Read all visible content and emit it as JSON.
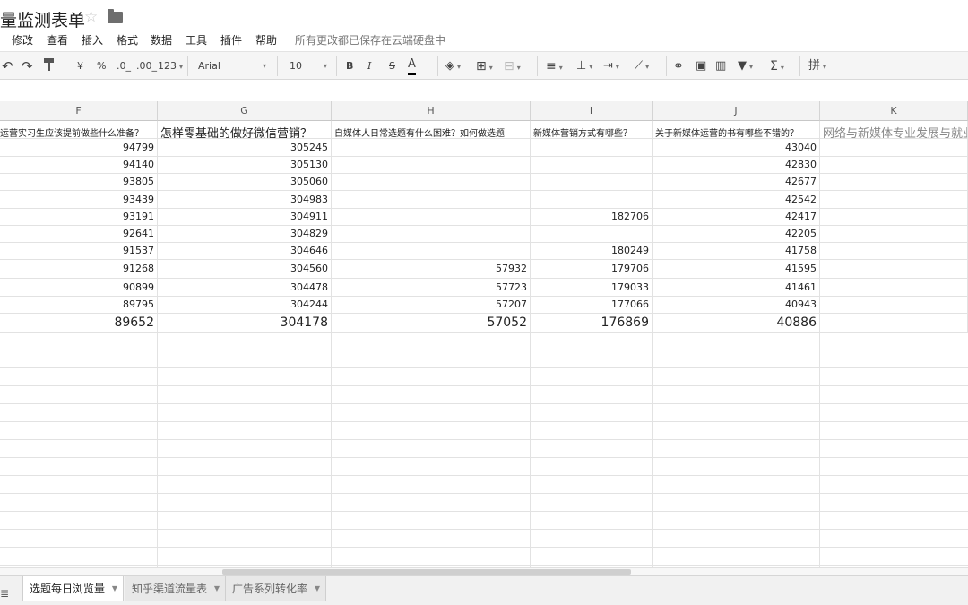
{
  "title": "量监测表单",
  "menu": [
    "修改",
    "查看",
    "插入",
    "格式",
    "数据",
    "工具",
    "插件",
    "帮助"
  ],
  "save_status": "所有更改都已保存在云端硬盘中",
  "toolbar": {
    "undo_icon": "undo-icon",
    "redo_icon": "redo-icon",
    "paint_icon": "paint-format-icon",
    "currency": "¥",
    "percent": "%",
    "dec_decrease": ".0_",
    "dec_increase": ".00_",
    "format_more": "123",
    "font": "Arial",
    "size": "10",
    "bold": "B",
    "italic": "I",
    "strike": "S",
    "textcolor": "A",
    "sum": "Σ",
    "input": "拼"
  },
  "columns": [
    "F",
    "G",
    "H",
    "I",
    "J",
    "K"
  ],
  "header_row": [
    "运营实习生应该提前做些什么准备？",
    "怎样零基础的做好微信营销？",
    "自媒体人日常选题有什么困难？如何做选题",
    "新媒体营销方式有哪些？",
    "关于新媒体运营的书有哪些不错的？",
    "网络与新媒体专业发展与就业"
  ],
  "rows": [
    [
      "94799",
      "305245",
      "",
      "",
      "43040",
      ""
    ],
    [
      "94140",
      "305130",
      "",
      "",
      "42830",
      ""
    ],
    [
      "93805",
      "305060",
      "",
      "",
      "42677",
      ""
    ],
    [
      "93439",
      "304983",
      "",
      "",
      "42542",
      ""
    ],
    [
      "93191",
      "304911",
      "",
      "182706",
      "42417",
      ""
    ],
    [
      "92641",
      "304829",
      "",
      "",
      "42205",
      ""
    ],
    [
      "91537",
      "304646",
      "",
      "180249",
      "41758",
      ""
    ],
    [
      "91268",
      "304560",
      "57932",
      "179706",
      "41595",
      ""
    ],
    [
      "90899",
      "304478",
      "57723",
      "179033",
      "41461",
      ""
    ],
    [
      "89795",
      "304244",
      "57207",
      "177066",
      "40943",
      ""
    ],
    [
      "89652",
      "304178",
      "57052",
      "176869",
      "40886",
      ""
    ]
  ],
  "sheets": [
    {
      "label": "选题每日浏览量",
      "active": true
    },
    {
      "label": "知乎渠道流量表",
      "active": false
    },
    {
      "label": "广告系列转化率",
      "active": false
    }
  ],
  "colors": {
    "toolbar_bg": "#f5f5f5",
    "header_bg": "#f3f3f3",
    "grid_line": "#e2e2e2"
  }
}
